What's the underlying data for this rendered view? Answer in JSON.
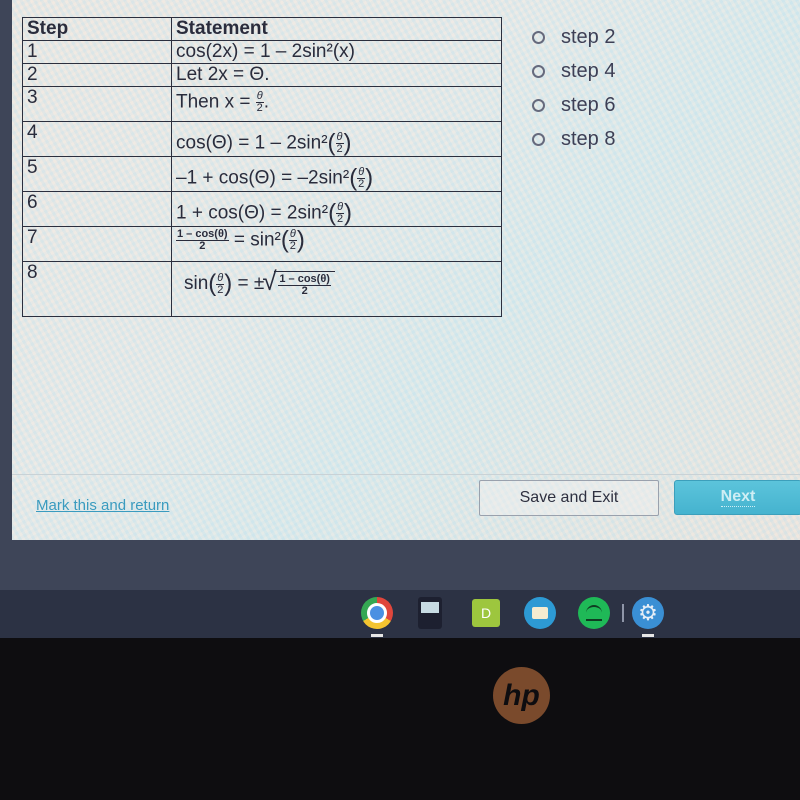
{
  "table": {
    "headers": [
      "Step",
      "Statement"
    ],
    "rows": [
      {
        "step": "1",
        "statement": "cos(2x) = 1 – 2sin²(x)"
      },
      {
        "step": "2",
        "statement": "Let 2x = Θ."
      },
      {
        "step": "3",
        "statement_prefix": "Then x = ",
        "frac_num": "θ",
        "frac_den": "2",
        "statement_suffix": "."
      },
      {
        "step": "4",
        "statement_prefix": "cos(Θ) = 1 – 2sin²",
        "frac_num": "θ",
        "frac_den": "2"
      },
      {
        "step": "5",
        "statement_prefix": "–1 + cos(Θ) = –2sin²",
        "frac_num": "θ",
        "frac_den": "2"
      },
      {
        "step": "6",
        "statement_prefix": "1 + cos(Θ) = 2sin²",
        "frac_num": "θ",
        "frac_den": "2"
      },
      {
        "step": "7",
        "lhs_num": "1 – cos(θ)",
        "lhs_den": "2",
        "statement_mid": " = sin²",
        "frac_num": "θ",
        "frac_den": "2"
      },
      {
        "step": "8",
        "statement_prefix": "sin",
        "frac_num": "θ",
        "frac_den": "2",
        "statement_mid": " = ±",
        "rad_num": "1 – cos(θ)",
        "rad_den": "2"
      }
    ]
  },
  "choices": [
    {
      "label": "step 2",
      "selected": false
    },
    {
      "label": "step 4",
      "selected": false
    },
    {
      "label": "step 6",
      "selected": false
    },
    {
      "label": "step 8",
      "selected": false
    }
  ],
  "footer": {
    "mark_link": "Mark this and return",
    "save_button": "Save and Exit",
    "next_button": "Next"
  },
  "shelf": {
    "apps": [
      "chrome-icon",
      "calculator-app-icon",
      "d-app-icon",
      "files-icon",
      "spotify-icon",
      "settings-icon"
    ],
    "d_app_letter": "D"
  },
  "bezel": {
    "logo_text": "hp"
  },
  "colors": {
    "link": "#3a9bbf",
    "next_button": "#4fbad4",
    "hp_logo": "#7a4a2c"
  }
}
